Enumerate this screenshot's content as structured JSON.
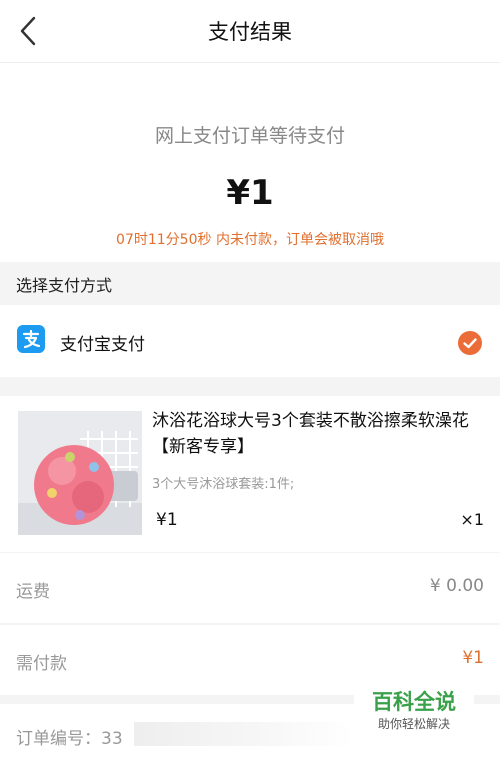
{
  "header": {
    "title": "支付结果"
  },
  "result": {
    "status": "网上支付订单等待支付",
    "amount": "¥1",
    "countdown": "07时11分50秒 内未付款，订单会被取消哦"
  },
  "payment": {
    "section_title": "选择支付方式",
    "method_label": "支付宝支付",
    "method_icon": "alipay-icon",
    "selected": true
  },
  "product": {
    "title": "沐浴花浴球大号3个套装不散浴擦柔软澡花【新客专享】",
    "spec": "3个大号沐浴球套装:1件;",
    "price": "¥1",
    "quantity": "×1"
  },
  "fees": {
    "shipping_label": "运费",
    "shipping_value": "¥ 0.00",
    "due_label": "需付款",
    "due_value": "¥1"
  },
  "order": {
    "number_label": "订单编号：",
    "number_value": "33"
  },
  "watermark": {
    "title": "百科全说",
    "subtitle": "助你轻松解决"
  },
  "colors": {
    "accent": "#e0702f",
    "check": "#ec6c38",
    "alipay": "#1c9bf0",
    "watermark": "#3aa14a"
  }
}
